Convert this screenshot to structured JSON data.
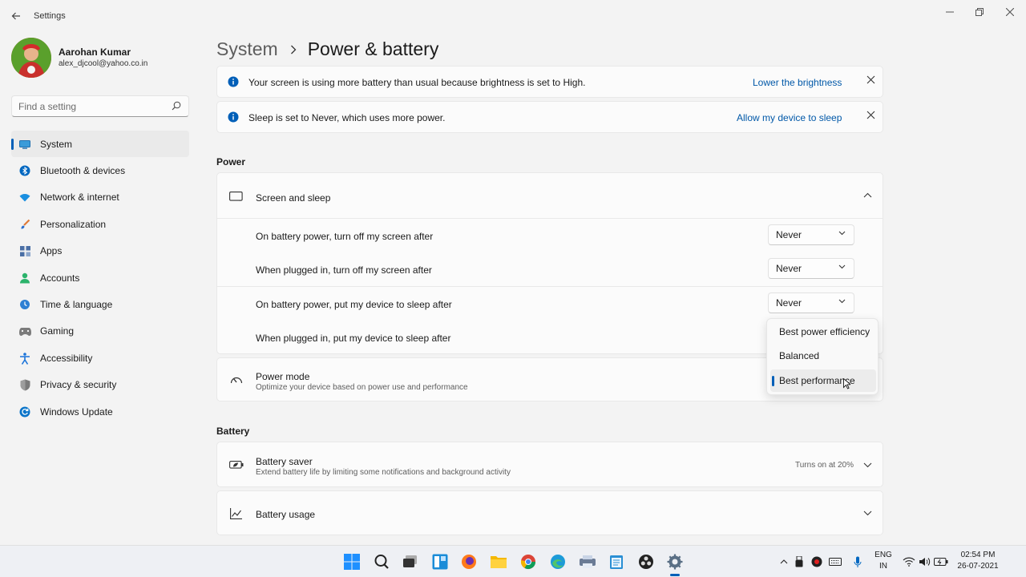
{
  "window": {
    "title": "Settings"
  },
  "user": {
    "name": "Aarohan Kumar",
    "email": "alex_djcool@yahoo.co.in"
  },
  "search": {
    "placeholder": "Find a setting"
  },
  "nav": [
    {
      "label": "System",
      "icon": "monitor-icon",
      "color": "#3a9bd9"
    },
    {
      "label": "Bluetooth & devices",
      "icon": "bluetooth-icon",
      "color": "#0067c0"
    },
    {
      "label": "Network & internet",
      "icon": "wifi-icon",
      "color": "#1a8fe0"
    },
    {
      "label": "Personalization",
      "icon": "brush-icon",
      "color": "#e07b39"
    },
    {
      "label": "Apps",
      "icon": "apps-icon",
      "color": "#4a6fa5"
    },
    {
      "label": "Accounts",
      "icon": "person-icon",
      "color": "#2bb36b"
    },
    {
      "label": "Time & language",
      "icon": "globe-clock-icon",
      "color": "#2d7fd3"
    },
    {
      "label": "Gaming",
      "icon": "controller-icon",
      "color": "#7b7b7b"
    },
    {
      "label": "Accessibility",
      "icon": "accessibility-icon",
      "color": "#1a73d9"
    },
    {
      "label": "Privacy & security",
      "icon": "shield-icon",
      "color": "#7a7a7a"
    },
    {
      "label": "Windows Update",
      "icon": "update-icon",
      "color": "#0a74c9"
    }
  ],
  "breadcrumb": {
    "parent": "System",
    "current": "Power & battery"
  },
  "notices": [
    {
      "text": "Your screen is using more battery than usual because brightness is set to High.",
      "link": "Lower the brightness"
    },
    {
      "text": "Sleep is set to Never, which uses more power.",
      "link": "Allow my device to sleep"
    }
  ],
  "power": {
    "section": "Power",
    "screen_sleep": {
      "title": "Screen and sleep",
      "rows": [
        {
          "label": "On battery power, turn off my screen after",
          "value": "Never"
        },
        {
          "label": "When plugged in, turn off my screen after",
          "value": "Never"
        },
        {
          "label": "On battery power, put my device to sleep after",
          "value": "Never"
        },
        {
          "label": "When plugged in, put my device to sleep after",
          "value": ""
        }
      ]
    },
    "power_mode": {
      "title": "Power mode",
      "subtitle": "Optimize your device based on power use and performance",
      "options": [
        "Best power efficiency",
        "Balanced",
        "Best performance"
      ],
      "selected": "Best performance"
    }
  },
  "battery": {
    "section": "Battery",
    "saver": {
      "title": "Battery saver",
      "subtitle": "Extend battery life by limiting some notifications and background activity",
      "status": "Turns on at 20%"
    },
    "usage": {
      "title": "Battery usage"
    }
  },
  "tray": {
    "lang": "ENG",
    "region": "IN",
    "time": "02:54 PM",
    "date": "26-07-2021"
  },
  "accent": "#005fb8"
}
